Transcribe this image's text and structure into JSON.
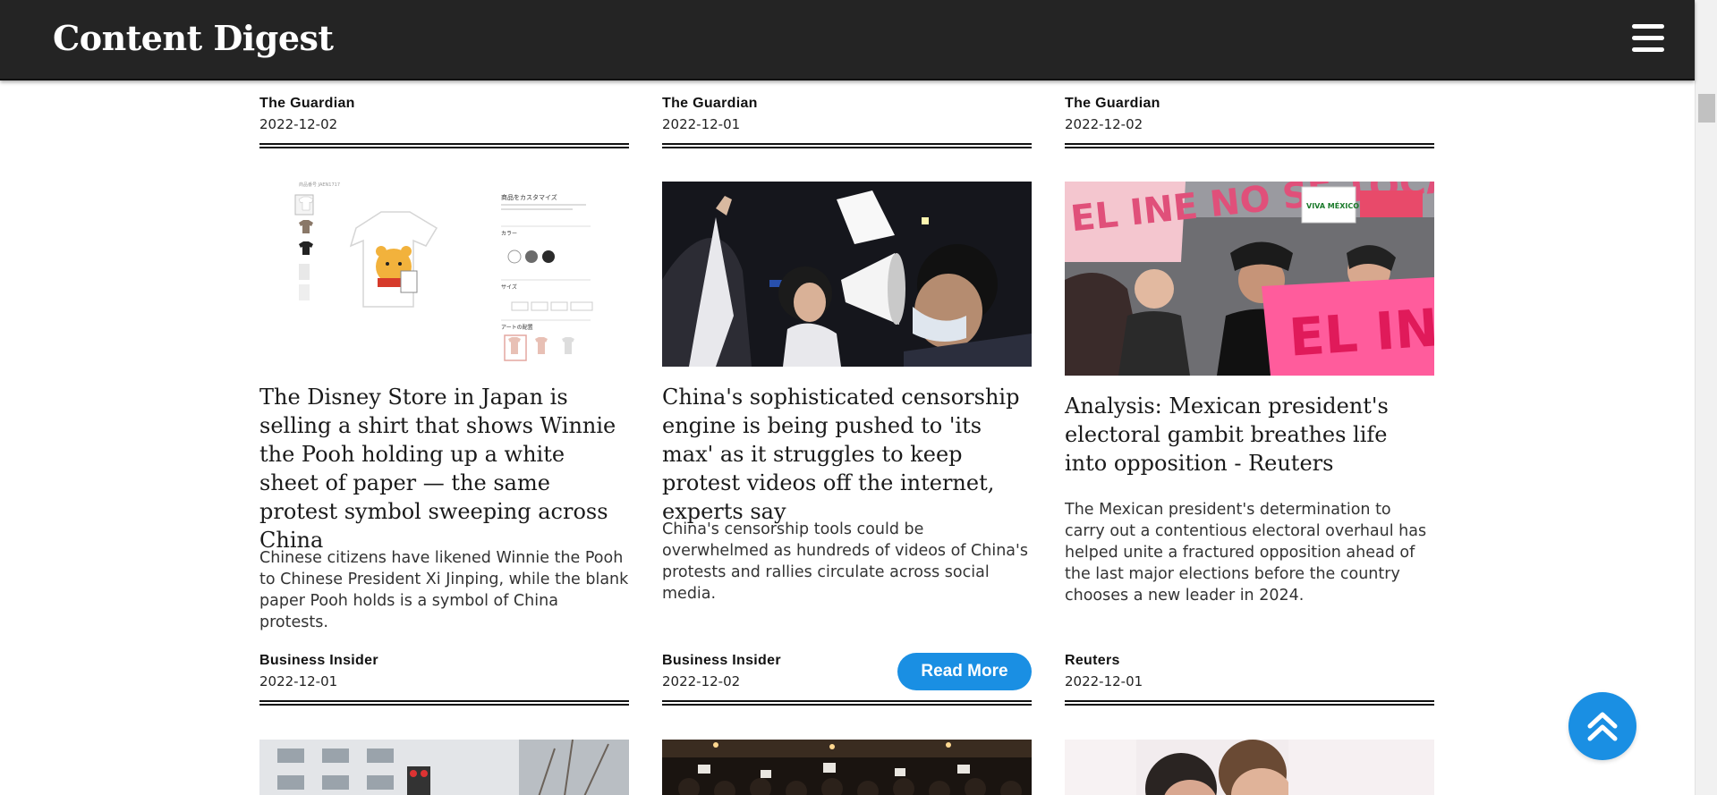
{
  "header": {
    "title": "Content Digest",
    "menu_icon": "hamburger-menu-icon"
  },
  "top_row": [
    {
      "source": "The Guardian",
      "date": "2022-12-02"
    },
    {
      "source": "The Guardian",
      "date": "2022-12-01"
    },
    {
      "source": "The Guardian",
      "date": "2022-12-02"
    }
  ],
  "cards": [
    {
      "title": "The Disney Store in Japan is selling a shirt that shows Winnie the Pooh holding up a white sheet of paper — the same protest symbol sweeping across China",
      "description": "Chinese citizens have likened Winnie the Pooh to Chinese President Xi Jinping, while the blank paper Pooh holds is a symbol of China protests.",
      "source": "Business Insider",
      "date": "2022-12-01"
    },
    {
      "title": "China's sophisticated censorship engine is being pushed to 'its max' as it struggles to keep protest videos off the internet, experts say",
      "description": "China's censorship tools could be overwhelmed as hundreds of videos of China's protests and rallies circulate across social media.",
      "source": "Business Insider",
      "date": "2022-12-02",
      "button": "Read More"
    },
    {
      "title": "Analysis: Mexican president's electoral gambit breathes life into opposition - Reuters",
      "description": "The Mexican president's determination to carry out a contentious electoral overhaul has helped unite a fractured opposition ahead of the last major elections before the country chooses a new leader in 2024.",
      "source": "Reuters",
      "date": "2022-12-01"
    }
  ],
  "thumbnail_1_text": {
    "heading": "商品をカスタマイズ",
    "color_label": "カラー",
    "size_label": "サイズ",
    "art_label": "アートの配置"
  },
  "protest_sign_text": {
    "sign_1": "EL INE NO SE TOCA",
    "sign_2": "VIVA MÉXICO",
    "sign_3": "EL INE"
  },
  "fab": {
    "icon": "double-chevron-up-icon"
  },
  "colors": {
    "header_bg": "#242424",
    "accent": "#1a8fe3"
  }
}
